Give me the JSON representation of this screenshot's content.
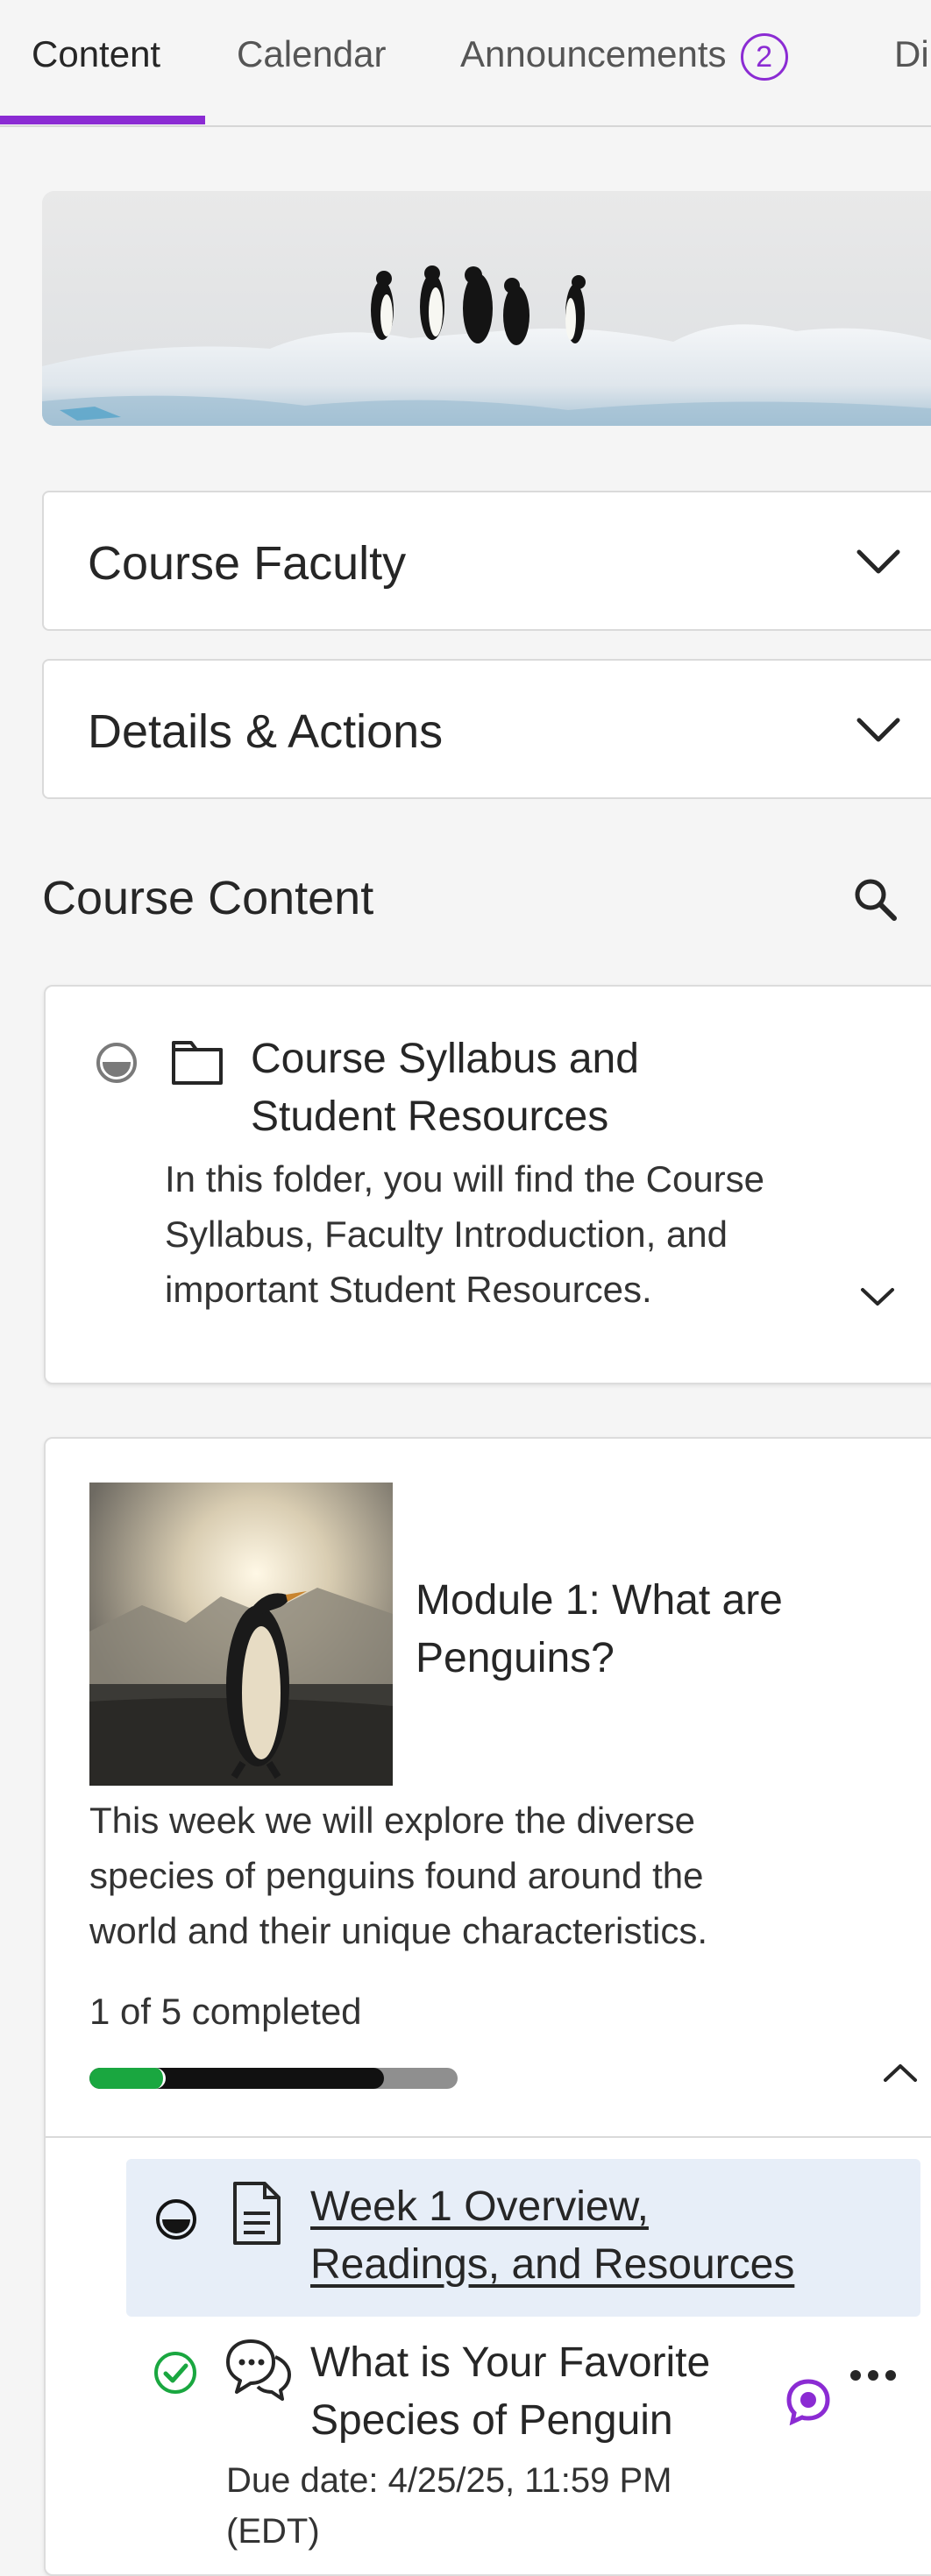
{
  "tabs": [
    {
      "label": "Content",
      "active": true
    },
    {
      "label": "Calendar",
      "active": false
    },
    {
      "label": "Announcements",
      "badge": "2",
      "active": false
    },
    {
      "label": "Di",
      "active": false
    }
  ],
  "panels": {
    "faculty": "Course Faculty",
    "details": "Details & Actions"
  },
  "course_content": {
    "heading": "Course Content"
  },
  "folder": {
    "title_line1": "Course Syllabus and",
    "title_line2": "Student Resources",
    "desc_line1": "In this folder, you will find the Course",
    "desc_line2": "Syllabus, Faculty Introduction, and",
    "desc_line3": "important Student Resources."
  },
  "module": {
    "title_line1": "Module 1: What are",
    "title_line2": "Penguins?",
    "desc_line1": "This week we will explore the diverse",
    "desc_line2": "species of penguins found around the",
    "desc_line3": "world and their unique characteristics.",
    "progress_text": "1 of 5 completed",
    "progress_completed_fraction": 0.2,
    "progress_started_fraction": 0.8
  },
  "items": [
    {
      "title_line1": "Week 1 Overview,",
      "title_line2": "Readings, and Resources",
      "status": "in-progress"
    },
    {
      "title_line1": "What is Your Favorite",
      "title_line2": "Species of Penguin",
      "due": "Due date: 4/25/25, 11:59 PM",
      "due_tz": "(EDT)",
      "status": "completed"
    }
  ],
  "colors": {
    "accent": "#8b2bd3",
    "complete_green": "#1aa740",
    "highlight_row": "#e7eef8"
  }
}
